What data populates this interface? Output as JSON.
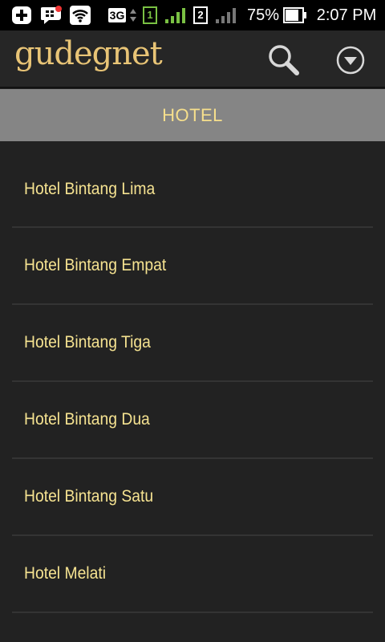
{
  "status_bar": {
    "network_type": "3G",
    "sim1": "1",
    "sim2": "2",
    "battery": "75%",
    "time": "2:07 PM"
  },
  "app_bar": {
    "logo_text": "gudegnet",
    "icons": [
      "search-icon",
      "dropdown-menu-icon"
    ]
  },
  "section": {
    "title": "HOTEL"
  },
  "list": {
    "items": [
      {
        "label": "Hotel Bintang Lima"
      },
      {
        "label": "Hotel Bintang Empat"
      },
      {
        "label": "Hotel Bintang Tiga"
      },
      {
        "label": "Hotel Bintang Dua"
      },
      {
        "label": "Hotel Bintang Satu"
      },
      {
        "label": "Hotel Melati"
      }
    ]
  },
  "colors": {
    "background": "#222222",
    "app_bar": "#262626",
    "section_header": "#858585",
    "accent_text": "#f6e391",
    "logo": "#e8c476"
  }
}
